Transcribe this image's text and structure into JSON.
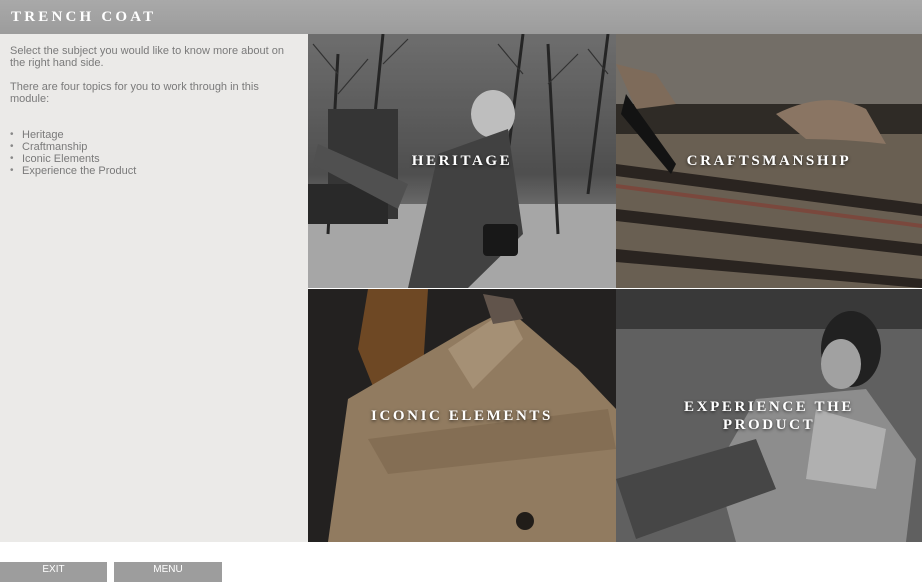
{
  "header": {
    "title": "TRENCH COAT"
  },
  "intro": {
    "line1": "Select the subject you would like to know more about on the right hand side.",
    "line2": "There are four topics for you to work through in this module:"
  },
  "topics": [
    "Heritage",
    "Craftmanship",
    "Iconic Elements",
    "Experience the Product"
  ],
  "tiles": [
    {
      "label": "HERITAGE"
    },
    {
      "label": "CRAFTSMANSHIP"
    },
    {
      "label": "ICONIC ELEMENTS"
    },
    {
      "label": "EXPERIENCE THE PRODUCT"
    }
  ],
  "footer": {
    "exit_label": "EXIT",
    "menu_label": "MENU"
  },
  "colors": {
    "header": "#a3a3a3",
    "panel": "#ebeae8",
    "button": "#9d9d9d",
    "text": "#7a7a7a"
  }
}
